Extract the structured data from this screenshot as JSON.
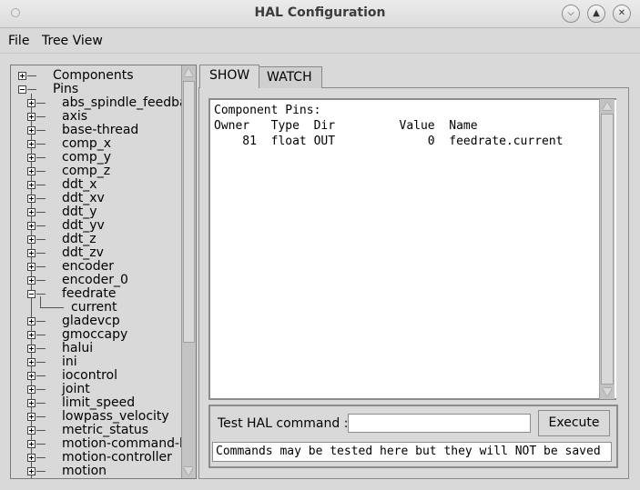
{
  "window": {
    "title": "HAL Configuration"
  },
  "menubar": {
    "items": [
      "File",
      "Tree View"
    ]
  },
  "tree": {
    "nodes": [
      {
        "label": "Components",
        "level": 0,
        "state": "collapsed"
      },
      {
        "label": "Pins",
        "level": 0,
        "state": "expanded"
      },
      {
        "label": "abs_spindle_feedback",
        "level": 1,
        "state": "collapsed"
      },
      {
        "label": "axis",
        "level": 1,
        "state": "collapsed"
      },
      {
        "label": "base-thread",
        "level": 1,
        "state": "collapsed"
      },
      {
        "label": "comp_x",
        "level": 1,
        "state": "collapsed"
      },
      {
        "label": "comp_y",
        "level": 1,
        "state": "collapsed"
      },
      {
        "label": "comp_z",
        "level": 1,
        "state": "collapsed"
      },
      {
        "label": "ddt_x",
        "level": 1,
        "state": "collapsed"
      },
      {
        "label": "ddt_xv",
        "level": 1,
        "state": "collapsed"
      },
      {
        "label": "ddt_y",
        "level": 1,
        "state": "collapsed"
      },
      {
        "label": "ddt_yv",
        "level": 1,
        "state": "collapsed"
      },
      {
        "label": "ddt_z",
        "level": 1,
        "state": "collapsed"
      },
      {
        "label": "ddt_zv",
        "level": 1,
        "state": "collapsed"
      },
      {
        "label": "encoder",
        "level": 1,
        "state": "collapsed"
      },
      {
        "label": "encoder_0",
        "level": 1,
        "state": "collapsed"
      },
      {
        "label": "feedrate",
        "level": 1,
        "state": "expanded"
      },
      {
        "label": "current",
        "level": 2,
        "state": "leaf"
      },
      {
        "label": "gladevcp",
        "level": 1,
        "state": "collapsed"
      },
      {
        "label": "gmoccapy",
        "level": 1,
        "state": "collapsed"
      },
      {
        "label": "halui",
        "level": 1,
        "state": "collapsed"
      },
      {
        "label": "ini",
        "level": 1,
        "state": "collapsed"
      },
      {
        "label": "iocontrol",
        "level": 1,
        "state": "collapsed"
      },
      {
        "label": "joint",
        "level": 1,
        "state": "collapsed"
      },
      {
        "label": "limit_speed",
        "level": 1,
        "state": "collapsed"
      },
      {
        "label": "lowpass_velocity",
        "level": 1,
        "state": "collapsed"
      },
      {
        "label": "metric_status",
        "level": 1,
        "state": "collapsed"
      },
      {
        "label": "motion-command-handler",
        "level": 1,
        "state": "collapsed"
      },
      {
        "label": "motion-controller",
        "level": 1,
        "state": "collapsed"
      },
      {
        "label": "motion",
        "level": 1,
        "state": "collapsed"
      }
    ]
  },
  "tabs": [
    {
      "label": "SHOW",
      "active": true
    },
    {
      "label": "WATCH",
      "active": false
    }
  ],
  "show_panel": {
    "lines": [
      "Component Pins:",
      "Owner   Type  Dir         Value  Name",
      "    81  float OUT             0  feedrate.current"
    ]
  },
  "command": {
    "label": "Test HAL command :",
    "input_value": "",
    "execute_label": "Execute",
    "status_text": "Commands may be tested here but they will NOT be saved"
  }
}
